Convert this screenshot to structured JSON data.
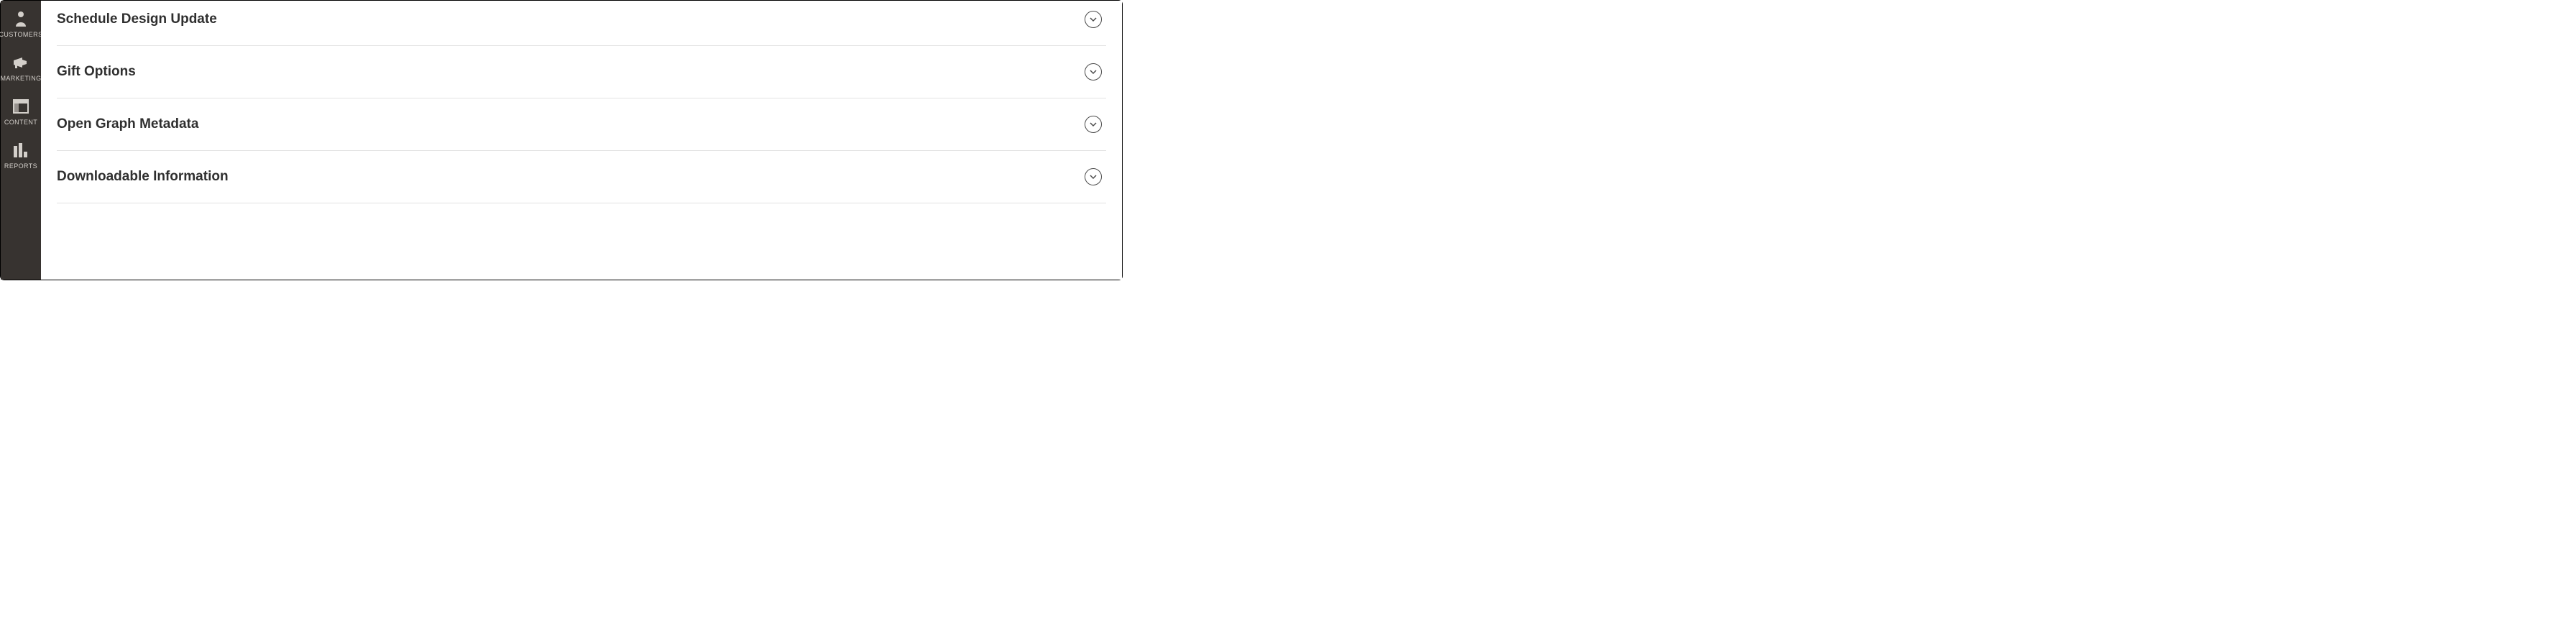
{
  "sidebar": {
    "items": [
      {
        "label": "CUSTOMERS",
        "icon": "person-icon"
      },
      {
        "label": "MARKETING",
        "icon": "megaphone-icon"
      },
      {
        "label": "CONTENT",
        "icon": "layout-icon"
      },
      {
        "label": "REPORTS",
        "icon": "bar-chart-icon"
      }
    ]
  },
  "main": {
    "sections": [
      {
        "title": "Schedule Design Update"
      },
      {
        "title": "Gift Options"
      },
      {
        "title": "Open Graph Metadata"
      },
      {
        "title": "Downloadable Information"
      }
    ]
  }
}
